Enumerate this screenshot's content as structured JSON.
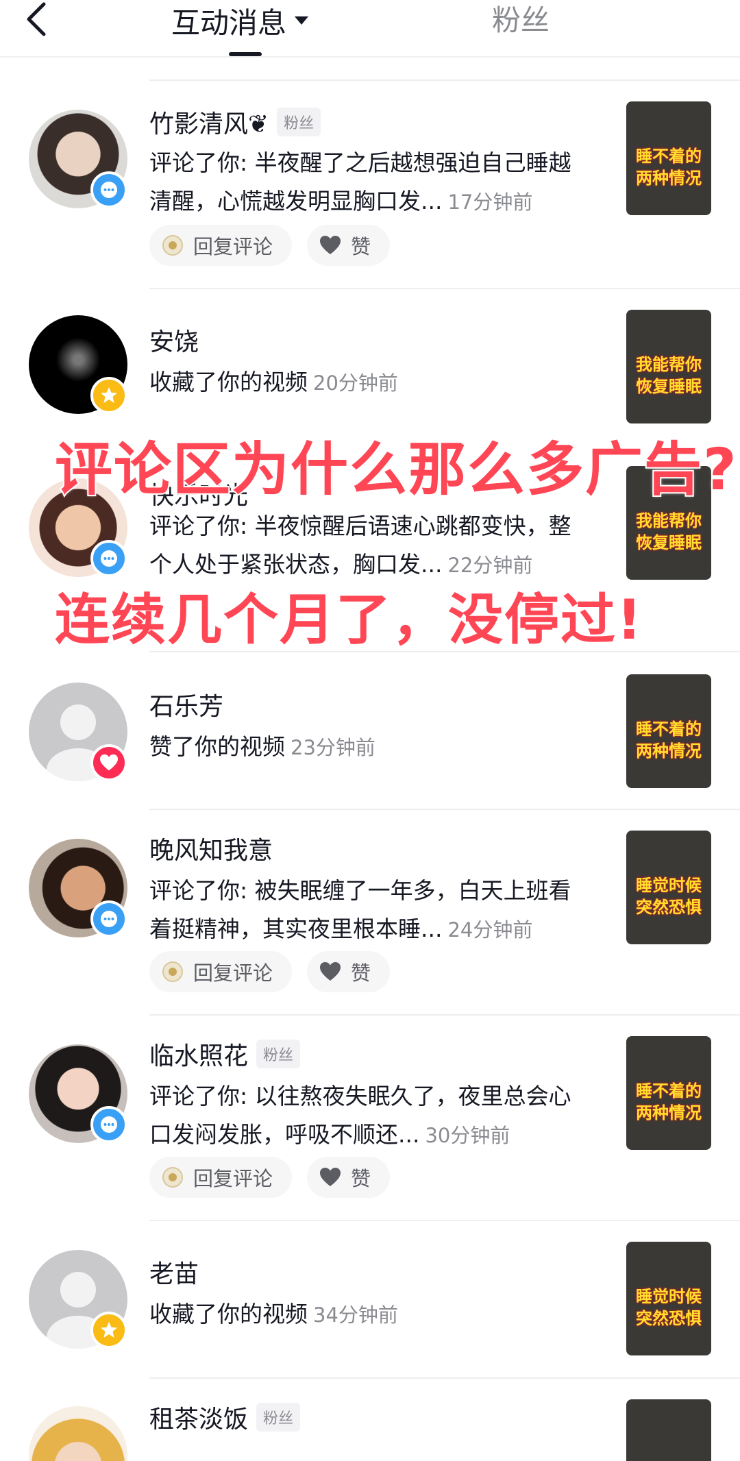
{
  "header": {
    "title": "互动消息",
    "fans_tab": "粉丝"
  },
  "overlay": {
    "line1": "评论区为什么那么多广告?",
    "line2": "连续几个月了，没停过!"
  },
  "actions": {
    "reply": "回复评论",
    "like": "赞"
  },
  "items": [
    {
      "name": "竹影清风❦",
      "tag": "粉丝",
      "line1": "评论了你: 半夜醒了之后越想强迫自己睡越",
      "line2": "清醒，心慌越发明显胸口发...",
      "time": "17分钟前",
      "badge": "comment",
      "thumb": [
        "睡不着的",
        "两种情况"
      ]
    },
    {
      "name": "安饶",
      "tag": "",
      "line1": "收藏了你的视频",
      "line2": "",
      "time": "20分钟前",
      "badge": "fav",
      "thumb": [
        "我能帮你",
        "恢复睡眠"
      ]
    },
    {
      "name": "快乐时光",
      "tag": "",
      "line1": "评论了你: 半夜惊醒后语速心跳都变快，整",
      "line2": "个人处于紧张状态，胸口发...",
      "time": "22分钟前",
      "badge": "comment",
      "thumb": [
        "我能帮你",
        "恢复睡眠"
      ]
    },
    {
      "name": "石乐芳",
      "tag": "",
      "line1": "赞了你的视频",
      "line2": "",
      "time": "23分钟前",
      "badge": "like",
      "thumb": [
        "睡不着的",
        "两种情况"
      ]
    },
    {
      "name": "晚风知我意",
      "tag": "",
      "line1": "评论了你: 被失眠缠了一年多，白天上班看",
      "line2": "着挺精神，其实夜里根本睡...",
      "time": "24分钟前",
      "badge": "comment",
      "thumb": [
        "睡觉时候",
        "突然恐惧"
      ]
    },
    {
      "name": "临水照花",
      "tag": "粉丝",
      "line1": "评论了你: 以往熬夜失眠久了，夜里总会心",
      "line2": "口发闷发胀，呼吸不顺还...",
      "time": "30分钟前",
      "badge": "comment",
      "thumb": [
        "睡不着的",
        "两种情况"
      ]
    },
    {
      "name": "老苗",
      "tag": "",
      "line1": "收藏了你的视频",
      "line2": "",
      "time": "34分钟前",
      "badge": "fav",
      "thumb": [
        "睡觉时候",
        "突然恐惧"
      ]
    },
    {
      "name": "租茶淡饭",
      "tag": "粉丝",
      "line1": "",
      "line2": "",
      "time": "",
      "badge": "none",
      "thumb": [
        "",
        ""
      ]
    }
  ]
}
